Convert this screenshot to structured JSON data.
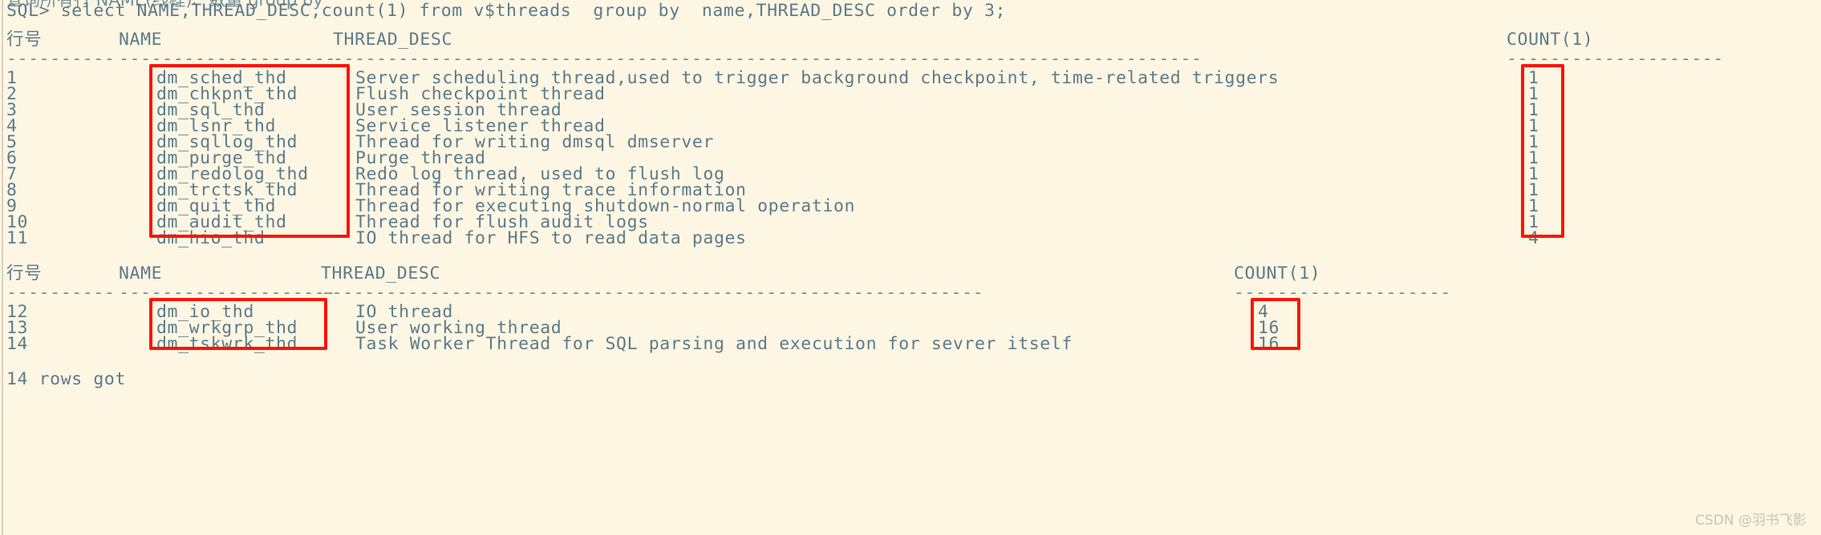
{
  "terminal": {
    "background_color": "#fdf6e3",
    "text_color": "#5c7b8a",
    "highlight_color": "#fc1405",
    "clipped_top_line": "查询所有行 NAME(线程)、数量 group by",
    "prompt_line": "SQL> select NAME,THREAD_DESC,count(1) from v$threads  group by  name,THREAD_DESC order by 3;",
    "footer": "14 rows got",
    "watermark": "CSDN @羽书飞影"
  },
  "result_block_1": {
    "headers": {
      "rownum": "行号",
      "name": "NAME",
      "desc": "THREAD_DESC",
      "count": "COUNT(1)"
    },
    "separator_rownum": "----------",
    "separator_name": "--------------------",
    "separator_desc": "--------------------------------------------------------------------------------",
    "separator_count": "--------------------",
    "rows": [
      {
        "rownum": "1",
        "name": "dm_sched_thd",
        "desc": "Server scheduling thread,used to trigger background checkpoint, time-related triggers",
        "count": "1"
      },
      {
        "rownum": "2",
        "name": "dm_chkpnt_thd",
        "desc": "Flush checkpoint thread",
        "count": "1"
      },
      {
        "rownum": "3",
        "name": "dm_sql_thd",
        "desc": "User session thread",
        "count": "1"
      },
      {
        "rownum": "4",
        "name": "dm_lsnr_thd",
        "desc": "Service listener thread",
        "count": "1"
      },
      {
        "rownum": "5",
        "name": "dm_sqllog_thd",
        "desc": "Thread for writing dmsql dmserver",
        "count": "1"
      },
      {
        "rownum": "6",
        "name": "dm_purge_thd",
        "desc": "Purge thread",
        "count": "1"
      },
      {
        "rownum": "7",
        "name": "dm_redolog_thd",
        "desc": "Redo log thread, used to flush log",
        "count": "1"
      },
      {
        "rownum": "8",
        "name": "dm_trctsk_thd",
        "desc": "Thread for writing trace information",
        "count": "1"
      },
      {
        "rownum": "9",
        "name": "dm_quit_thd",
        "desc": "Thread for executing shutdown-normal operation",
        "count": "1"
      },
      {
        "rownum": "10",
        "name": "dm_audit_thd",
        "desc": "Thread for flush audit logs",
        "count": "1"
      },
      {
        "rownum": "11",
        "name": "dm_hio_thd",
        "desc": "IO thread for HFS to read data pages",
        "count": "4"
      }
    ]
  },
  "result_block_2": {
    "headers": {
      "rownum": "行号",
      "name": "NAME",
      "desc": "THREAD_DESC",
      "count": "COUNT(1)"
    },
    "separator_rownum": "----------",
    "separator_name": "--------------------",
    "separator_desc": "-------------------------------------------------------------",
    "separator_count": "--------------------",
    "rows": [
      {
        "rownum": "12",
        "name": "dm_io_thd",
        "desc": "IO thread",
        "count": "4"
      },
      {
        "rownum": "13",
        "name": "dm_wrkgrp_thd",
        "desc": "User working thread",
        "count": "16"
      },
      {
        "rownum": "14",
        "name": "dm_tskwrk_thd",
        "desc": "Task Worker Thread for SQL parsing and execution for sevrer itself",
        "count": "16"
      }
    ]
  },
  "annotations": {
    "boxes": [
      {
        "id": "name-column-box-1",
        "label": "red-highlight-name-column-block-1"
      },
      {
        "id": "count-column-box-1",
        "label": "red-highlight-count-column-block-1"
      },
      {
        "id": "name-column-box-2",
        "label": "red-highlight-name-column-block-2"
      },
      {
        "id": "count-column-box-2",
        "label": "red-highlight-count-column-block-2"
      }
    ]
  }
}
